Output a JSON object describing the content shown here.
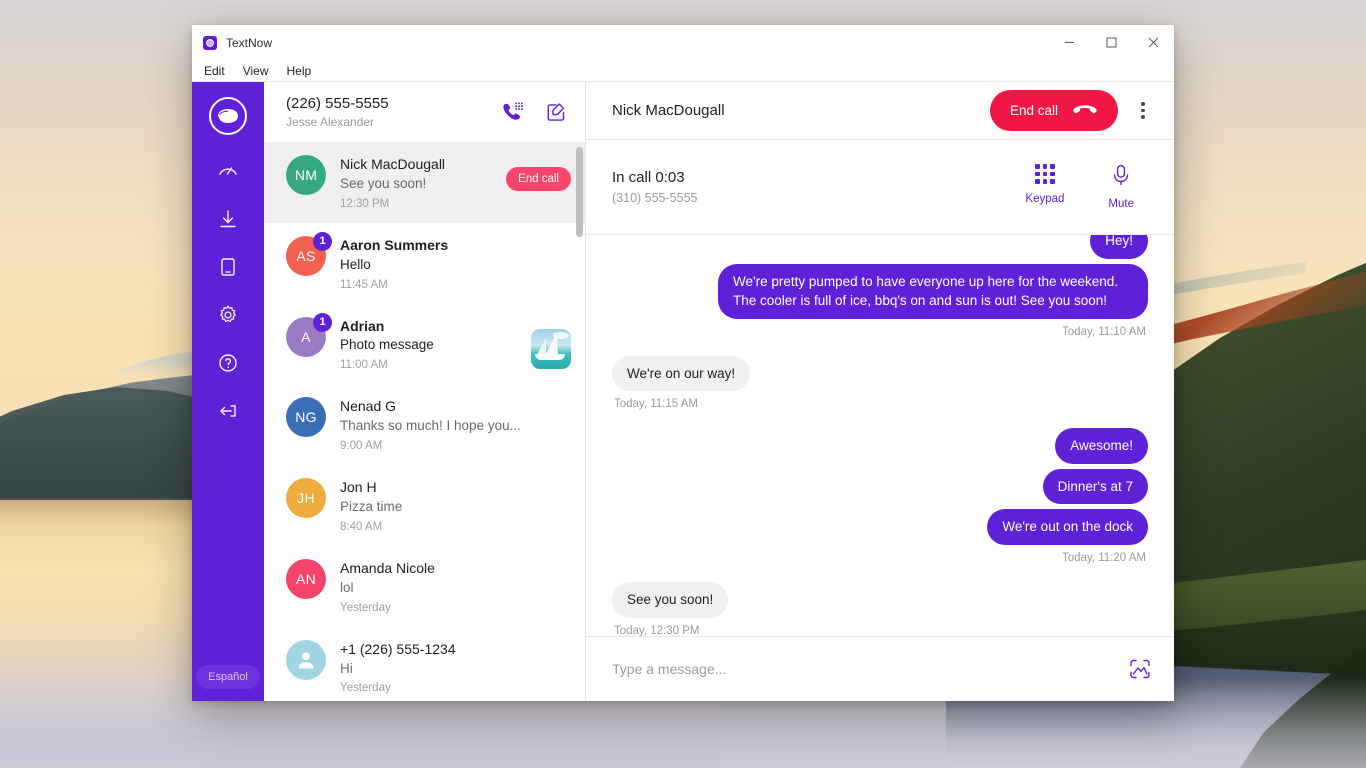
{
  "window": {
    "app_title": "TextNow",
    "app_icon": "textnow-logo-icon",
    "controls": {
      "minimize": "minimize-icon",
      "maximize": "maximize-icon",
      "close": "close-icon"
    },
    "menus": [
      "Edit",
      "View",
      "Help"
    ]
  },
  "rail": {
    "logo": "textnow-logo-icon",
    "items": [
      {
        "name": "speedometer-icon",
        "label": "Usage"
      },
      {
        "name": "download-icon",
        "label": "Download"
      },
      {
        "name": "device-icon",
        "label": "Devices"
      },
      {
        "name": "gear-icon",
        "label": "Settings"
      },
      {
        "name": "help-icon",
        "label": "Help"
      },
      {
        "name": "logout-icon",
        "label": "Log out"
      }
    ],
    "language_button": "Español"
  },
  "conversations_header": {
    "number": "(226) 555-5555",
    "account_name": "Jesse Alexander",
    "dialpad_icon": "phone-dialpad-icon",
    "compose_icon": "compose-icon"
  },
  "conversations": [
    {
      "initials": "NM",
      "color": "#37a884",
      "name": "Nick MacDougall",
      "preview": "See you soon!",
      "time": "12:30 PM",
      "active": true,
      "unread": 0,
      "badge": "",
      "action_label": "End call",
      "thumb": false
    },
    {
      "initials": "AS",
      "color": "#f4604f",
      "name": "Aaron Summers",
      "preview": "Hello",
      "time": "11:45 AM",
      "active": false,
      "unread": 1,
      "badge": "1",
      "action_label": "",
      "thumb": false
    },
    {
      "initials": "A",
      "color": "#9b7ac4",
      "name": "Adrian",
      "preview": "Photo message",
      "time": "11:00 AM",
      "active": false,
      "unread": 1,
      "badge": "1",
      "action_label": "",
      "thumb": true
    },
    {
      "initials": "NG",
      "color": "#3a6db5",
      "name": "Nenad G",
      "preview": "Thanks so much! I hope you...",
      "time": "9:00 AM",
      "active": false,
      "unread": 0,
      "badge": "",
      "action_label": "",
      "thumb": false
    },
    {
      "initials": "JH",
      "color": "#eeab3e",
      "name": "Jon H",
      "preview": "Pizza time",
      "time": "8:40 AM",
      "active": false,
      "unread": 0,
      "badge": "",
      "action_label": "",
      "thumb": false
    },
    {
      "initials": "AN",
      "color": "#f3456b",
      "name": "Amanda Nicole",
      "preview": "lol",
      "time": "Yesterday",
      "active": false,
      "unread": 0,
      "badge": "",
      "action_label": "",
      "thumb": false
    },
    {
      "initials": "",
      "color": "#9fd4e0",
      "name": "+1 (226) 555-1234",
      "preview": "Hi",
      "time": "Yesterday",
      "active": false,
      "unread": 0,
      "badge": "",
      "action_label": "",
      "thumb": false
    }
  ],
  "chat": {
    "title": "Nick MacDougall",
    "end_call_label": "End call",
    "end_call_icon": "hangup-phone-icon",
    "overflow_icon": "kebab-menu-icon",
    "call": {
      "status": "In call 0:03",
      "number": "(310) 555-5555",
      "actions": [
        {
          "icon": "dialpad-icon",
          "label": "Keypad"
        },
        {
          "icon": "microphone-icon",
          "label": "Mute"
        }
      ]
    },
    "messages": [
      {
        "side": "out",
        "bubbles": [
          "Hey!"
        ],
        "stamp": "",
        "clipped": true
      },
      {
        "side": "out",
        "bubbles": [
          "We're pretty pumped to have everyone up here for the weekend. The cooler is full of ice, bbq's on and sun is out!  See you soon!"
        ],
        "stamp": "Today, 11:10 AM",
        "clipped": false
      },
      {
        "side": "in",
        "bubbles": [
          "We're on our way!"
        ],
        "stamp": "Today, 11:15 AM",
        "clipped": false
      },
      {
        "side": "out",
        "bubbles": [
          "Awesome!",
          "Dinner's at 7",
          "We're out on the dock"
        ],
        "stamp": "Today, 11:20 AM",
        "clipped": false
      },
      {
        "side": "in",
        "bubbles": [
          "See you soon!"
        ],
        "stamp": "Today, 12:30 PM",
        "clipped": false
      }
    ],
    "composer": {
      "placeholder": "Type a message...",
      "value": "",
      "attach_icon": "image-attach-icon"
    }
  },
  "colors": {
    "brand_purple": "#5f21d8",
    "end_call_red": "#f01744",
    "end_call_pill": "#f8456b",
    "bubble_in": "#f0f0f0"
  }
}
